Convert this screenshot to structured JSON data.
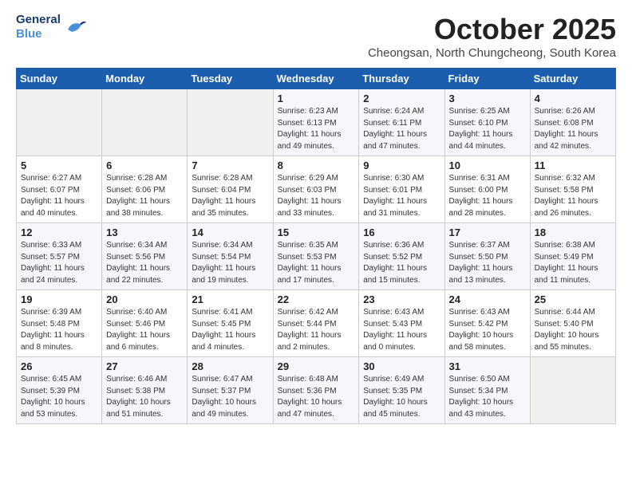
{
  "logo": {
    "line1": "General",
    "line2": "Blue"
  },
  "title": "October 2025",
  "subtitle": "Cheongsan, North Chungcheong, South Korea",
  "days_of_week": [
    "Sunday",
    "Monday",
    "Tuesday",
    "Wednesday",
    "Thursday",
    "Friday",
    "Saturday"
  ],
  "weeks": [
    [
      {
        "day": "",
        "info": ""
      },
      {
        "day": "",
        "info": ""
      },
      {
        "day": "",
        "info": ""
      },
      {
        "day": "1",
        "info": "Sunrise: 6:23 AM\nSunset: 6:13 PM\nDaylight: 11 hours\nand 49 minutes."
      },
      {
        "day": "2",
        "info": "Sunrise: 6:24 AM\nSunset: 6:11 PM\nDaylight: 11 hours\nand 47 minutes."
      },
      {
        "day": "3",
        "info": "Sunrise: 6:25 AM\nSunset: 6:10 PM\nDaylight: 11 hours\nand 44 minutes."
      },
      {
        "day": "4",
        "info": "Sunrise: 6:26 AM\nSunset: 6:08 PM\nDaylight: 11 hours\nand 42 minutes."
      }
    ],
    [
      {
        "day": "5",
        "info": "Sunrise: 6:27 AM\nSunset: 6:07 PM\nDaylight: 11 hours\nand 40 minutes."
      },
      {
        "day": "6",
        "info": "Sunrise: 6:28 AM\nSunset: 6:06 PM\nDaylight: 11 hours\nand 38 minutes."
      },
      {
        "day": "7",
        "info": "Sunrise: 6:28 AM\nSunset: 6:04 PM\nDaylight: 11 hours\nand 35 minutes."
      },
      {
        "day": "8",
        "info": "Sunrise: 6:29 AM\nSunset: 6:03 PM\nDaylight: 11 hours\nand 33 minutes."
      },
      {
        "day": "9",
        "info": "Sunrise: 6:30 AM\nSunset: 6:01 PM\nDaylight: 11 hours\nand 31 minutes."
      },
      {
        "day": "10",
        "info": "Sunrise: 6:31 AM\nSunset: 6:00 PM\nDaylight: 11 hours\nand 28 minutes."
      },
      {
        "day": "11",
        "info": "Sunrise: 6:32 AM\nSunset: 5:58 PM\nDaylight: 11 hours\nand 26 minutes."
      }
    ],
    [
      {
        "day": "12",
        "info": "Sunrise: 6:33 AM\nSunset: 5:57 PM\nDaylight: 11 hours\nand 24 minutes."
      },
      {
        "day": "13",
        "info": "Sunrise: 6:34 AM\nSunset: 5:56 PM\nDaylight: 11 hours\nand 22 minutes."
      },
      {
        "day": "14",
        "info": "Sunrise: 6:34 AM\nSunset: 5:54 PM\nDaylight: 11 hours\nand 19 minutes."
      },
      {
        "day": "15",
        "info": "Sunrise: 6:35 AM\nSunset: 5:53 PM\nDaylight: 11 hours\nand 17 minutes."
      },
      {
        "day": "16",
        "info": "Sunrise: 6:36 AM\nSunset: 5:52 PM\nDaylight: 11 hours\nand 15 minutes."
      },
      {
        "day": "17",
        "info": "Sunrise: 6:37 AM\nSunset: 5:50 PM\nDaylight: 11 hours\nand 13 minutes."
      },
      {
        "day": "18",
        "info": "Sunrise: 6:38 AM\nSunset: 5:49 PM\nDaylight: 11 hours\nand 11 minutes."
      }
    ],
    [
      {
        "day": "19",
        "info": "Sunrise: 6:39 AM\nSunset: 5:48 PM\nDaylight: 11 hours\nand 8 minutes."
      },
      {
        "day": "20",
        "info": "Sunrise: 6:40 AM\nSunset: 5:46 PM\nDaylight: 11 hours\nand 6 minutes."
      },
      {
        "day": "21",
        "info": "Sunrise: 6:41 AM\nSunset: 5:45 PM\nDaylight: 11 hours\nand 4 minutes."
      },
      {
        "day": "22",
        "info": "Sunrise: 6:42 AM\nSunset: 5:44 PM\nDaylight: 11 hours\nand 2 minutes."
      },
      {
        "day": "23",
        "info": "Sunrise: 6:43 AM\nSunset: 5:43 PM\nDaylight: 11 hours\nand 0 minutes."
      },
      {
        "day": "24",
        "info": "Sunrise: 6:43 AM\nSunset: 5:42 PM\nDaylight: 10 hours\nand 58 minutes."
      },
      {
        "day": "25",
        "info": "Sunrise: 6:44 AM\nSunset: 5:40 PM\nDaylight: 10 hours\nand 55 minutes."
      }
    ],
    [
      {
        "day": "26",
        "info": "Sunrise: 6:45 AM\nSunset: 5:39 PM\nDaylight: 10 hours\nand 53 minutes."
      },
      {
        "day": "27",
        "info": "Sunrise: 6:46 AM\nSunset: 5:38 PM\nDaylight: 10 hours\nand 51 minutes."
      },
      {
        "day": "28",
        "info": "Sunrise: 6:47 AM\nSunset: 5:37 PM\nDaylight: 10 hours\nand 49 minutes."
      },
      {
        "day": "29",
        "info": "Sunrise: 6:48 AM\nSunset: 5:36 PM\nDaylight: 10 hours\nand 47 minutes."
      },
      {
        "day": "30",
        "info": "Sunrise: 6:49 AM\nSunset: 5:35 PM\nDaylight: 10 hours\nand 45 minutes."
      },
      {
        "day": "31",
        "info": "Sunrise: 6:50 AM\nSunset: 5:34 PM\nDaylight: 10 hours\nand 43 minutes."
      },
      {
        "day": "",
        "info": ""
      }
    ]
  ]
}
